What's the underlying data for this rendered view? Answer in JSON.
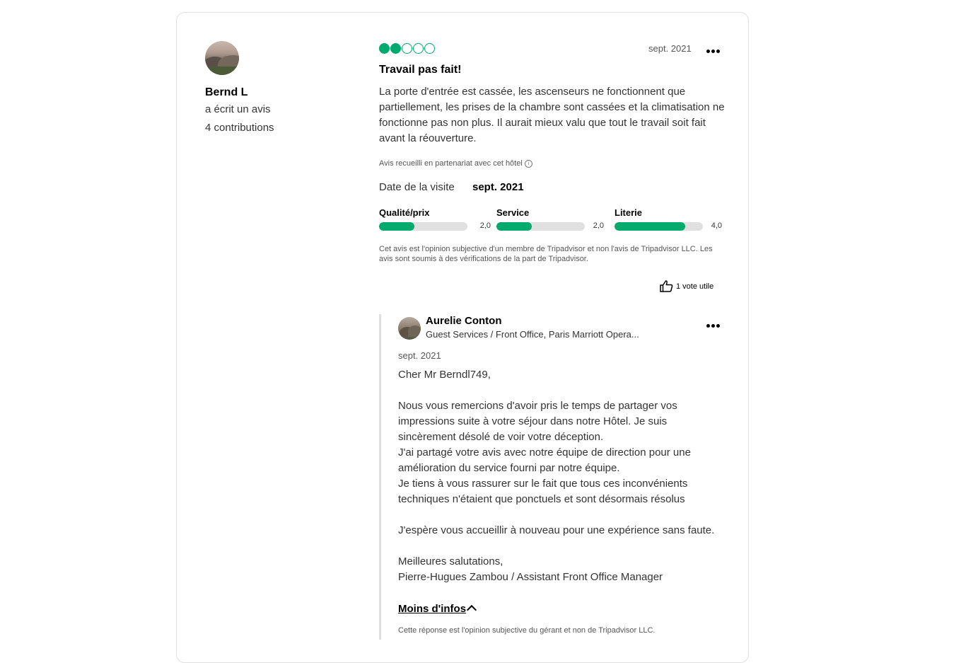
{
  "reviewer": {
    "name": "Bernd L",
    "action": "a écrit un avis",
    "contributions": "4 contributions"
  },
  "review": {
    "rating": 2,
    "rating_max": 5,
    "date": "sept. 2021",
    "title": "Travail pas fait!",
    "text": "La porte d'entrée est cassée, les ascenseurs ne fonctionnent que partiellement, les prises de la chambre sont cassées et la climatisation ne fonctionne pas non plus. Il aurait mieux valu que tout le travail soit fait avant la réouverture.",
    "partner_note": "Avis recueilli en partenariat avec cet hôtel",
    "visit_label": "Date de la visite",
    "visit_value": "sept. 2021",
    "sub_ratings": [
      {
        "label": "Qualité/prix",
        "value": "2,0",
        "score": 2.0
      },
      {
        "label": "Service",
        "value": "2,0",
        "score": 2.0
      },
      {
        "label": "Literie",
        "value": "4,0",
        "score": 4.0
      }
    ],
    "disclaimer": "Cet avis est l'opinion subjective d'un membre de Tripadvisor et non l'avis de Tripadvisor LLC. Les avis sont soumis à des vérifications de la part de Tripadvisor.",
    "helpful_label": "1 vote utile"
  },
  "response": {
    "responder_name": "Aurelie Conton",
    "responder_role": "Guest Services / Front Office, Paris Marriott Opera...",
    "date": "sept. 2021",
    "text": "Cher Mr Berndl749,\n\nNous vous remercions d'avoir pris le temps de partager vos impressions suite à votre séjour dans notre Hôtel. Je suis sincèrement désolé de voir votre déception.\nJ'ai partagé votre avis avec notre équipe de direction pour une amélioration du service fourni par notre équipe.\nJe tiens à vous rassurer sur le fait que tous ces inconvénients techniques n'étaient que ponctuels et sont désormais résolus\n\nJ'espère vous accueillir à nouveau pour une expérience sans faute.\n\nMeilleures salutations,\nPierre-Hugues Zambou / Assistant Front Office Manager",
    "less_info": "Moins d'infos",
    "disclaimer": "Cette réponse est l'opinion subjective du gérant et non de Tripadvisor LLC."
  },
  "colors": {
    "accent": "#00aa6c",
    "track": "#e0e0e0"
  },
  "icons": [
    "more-options-icon",
    "info-icon",
    "thumbs-up-icon",
    "chevron-up-icon"
  ]
}
